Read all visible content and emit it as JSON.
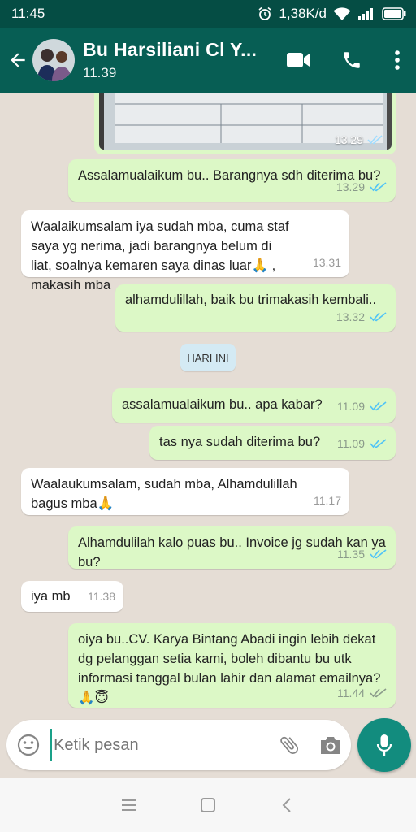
{
  "status_bar": {
    "time": "11:45",
    "network_speed": "1,38K/d"
  },
  "header": {
    "contact_name": "Bu Harsiliani Cl Y...",
    "subtitle": "11.39"
  },
  "image_message": {
    "time": "13.29"
  },
  "day_divider": "HARI INI",
  "messages": [
    {
      "direction": "out",
      "text": "Assalamualaikum bu.. Barangnya sdh diterima bu?",
      "time": "13.29",
      "status": "read"
    },
    {
      "direction": "in",
      "text": "Waalaikumsalam iya sudah mba, cuma staf saya yg nerima, jadi barangnya belum di liat, soalnya kemaren saya dinas luar🙏 , makasih mba",
      "time": "13.31"
    },
    {
      "direction": "out",
      "text": "alhamdulillah, baik bu trimakasih kembali..",
      "time": "13.32",
      "status": "read"
    },
    {
      "direction": "out",
      "text": "assalamualaikum bu.. apa kabar?",
      "time": "11.09",
      "status": "read"
    },
    {
      "direction": "out",
      "text": "tas nya sudah diterima bu?",
      "time": "11.09",
      "status": "read"
    },
    {
      "direction": "in",
      "text": "Waalaukumsalam, sudah mba, Alhamdulillah bagus mba🙏",
      "time": "11.17"
    },
    {
      "direction": "out",
      "text": "Alhamdulilah kalo puas bu.. Invoice jg sudah kan ya bu?",
      "time": "11.35",
      "status": "read"
    },
    {
      "direction": "in",
      "text": "iya mb",
      "time": "11.38"
    },
    {
      "direction": "out",
      "text": "oiya bu..CV. Karya Bintang Abadi ingin lebih dekat dg pelanggan setia kami, boleh dibantu bu utk informasi tanggal bulan lahir dan alamat emailnya?🙏😇",
      "time": "11.44",
      "status": "delivered"
    }
  ],
  "input": {
    "placeholder": "Ketik pesan"
  },
  "colors": {
    "header": "#075e54",
    "status_bar": "#054d44",
    "outgoing_bubble": "#dcf8c6",
    "incoming_bubble": "#ffffff",
    "read_tick": "#4fc3f7",
    "mic_button": "#128c7e"
  }
}
